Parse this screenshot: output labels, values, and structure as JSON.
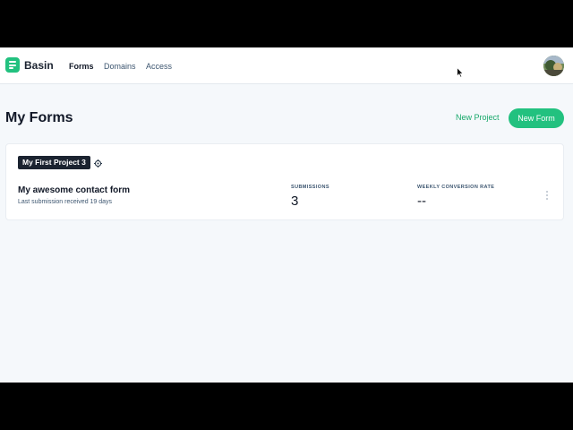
{
  "app": {
    "brand": "Basin"
  },
  "nav": {
    "items": [
      {
        "label": "Forms",
        "active": true
      },
      {
        "label": "Domains",
        "active": false
      },
      {
        "label": "Access",
        "active": false
      }
    ]
  },
  "page": {
    "title": "My Forms",
    "new_project_label": "New Project",
    "new_form_label": "New Form"
  },
  "project": {
    "name": "My First Project 3",
    "forms": [
      {
        "name": "My awesome contact form",
        "last_submission": "Last submission received 19 days",
        "submissions_label": "SUBMISSIONS",
        "submissions_value": "3",
        "conversion_label": "WEEKLY CONVERSION RATE",
        "conversion_value": "--"
      }
    ]
  },
  "colors": {
    "accent": "#22c17f",
    "accent_text": "#17a86a",
    "badge_bg": "#1b2330",
    "page_bg": "#f5f8fb"
  },
  "icons": [
    "logo-icon",
    "settings-icon",
    "kebab-menu-icon",
    "avatar",
    "mouse-cursor"
  ]
}
